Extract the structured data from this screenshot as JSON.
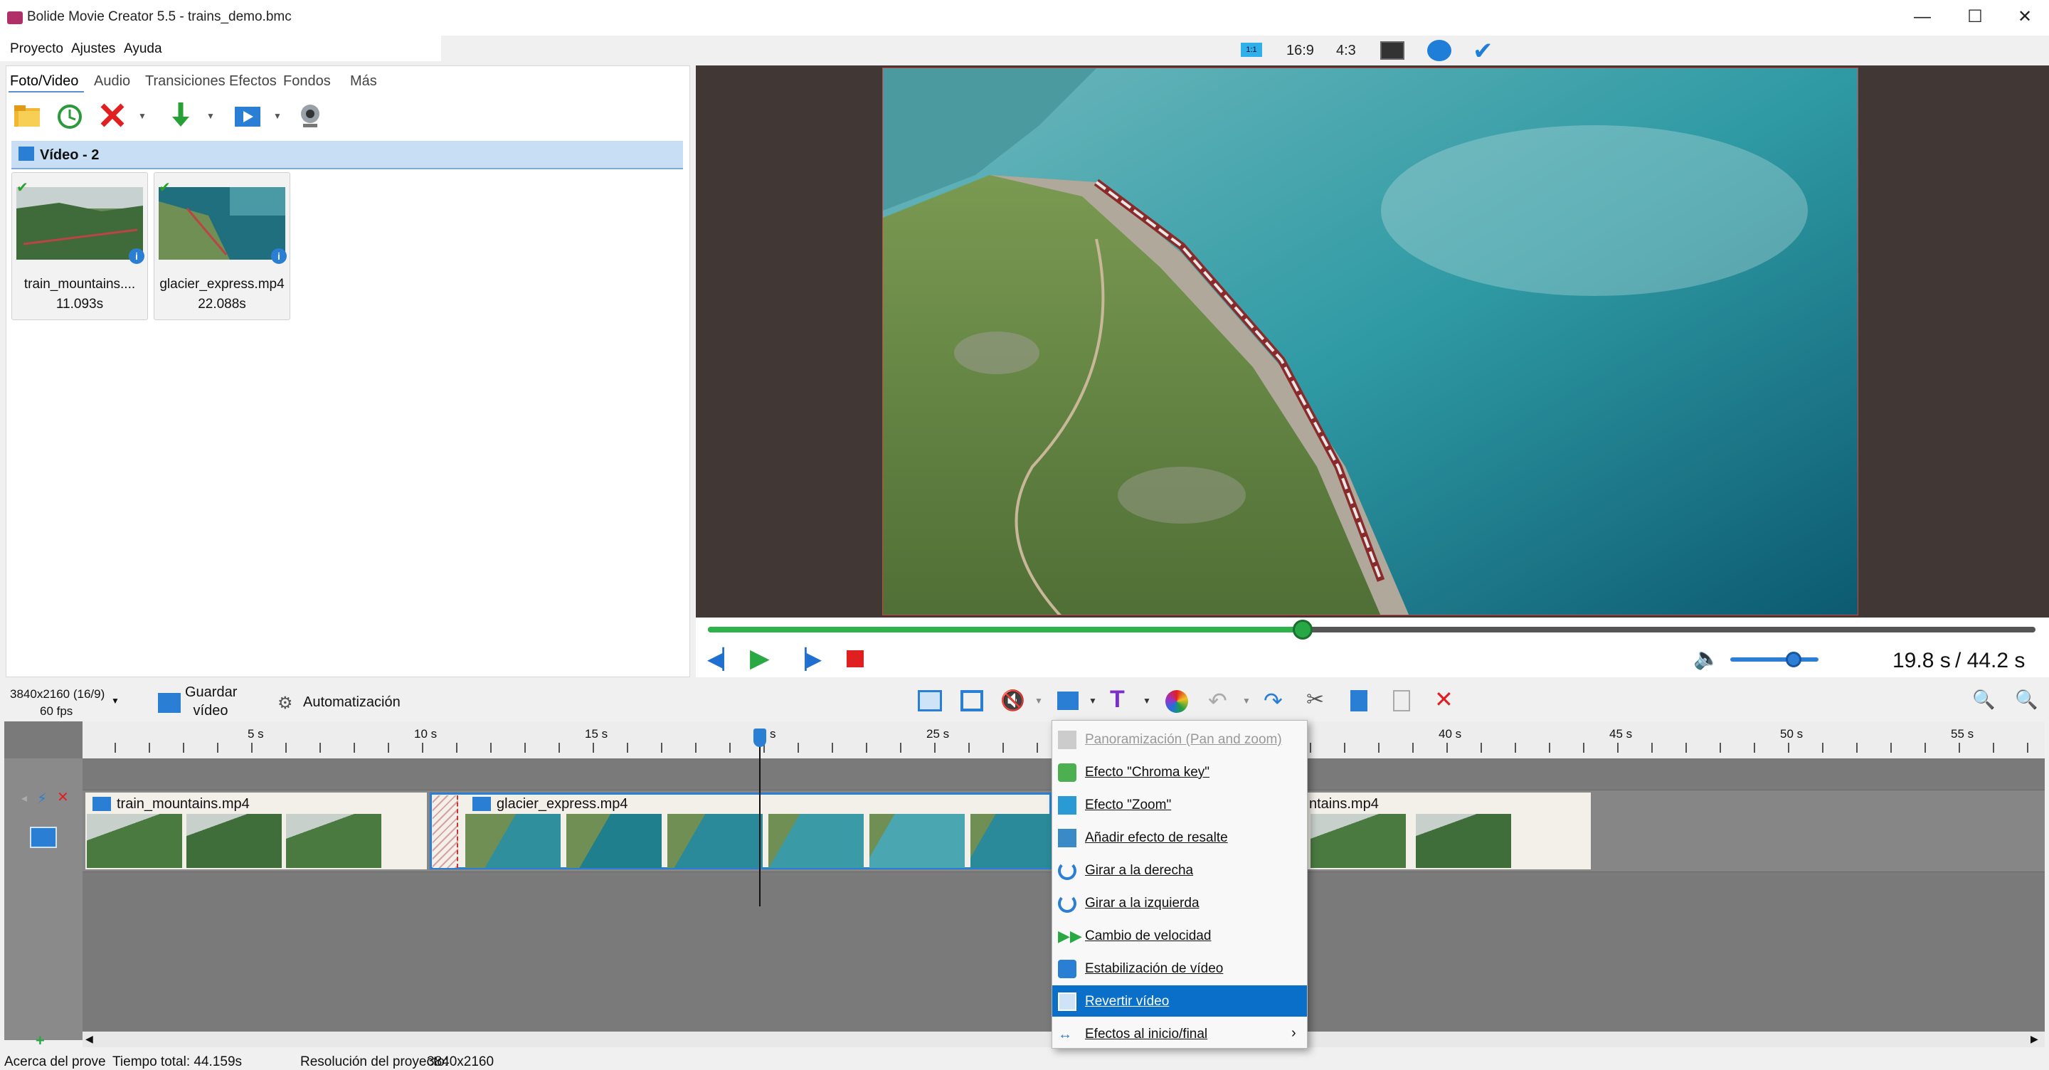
{
  "window": {
    "title": "Bolide Movie Creator 5.5 - trains_demo.bmc"
  },
  "menubar": [
    "Proyecto",
    "Ajustes",
    "Ayuda"
  ],
  "top_icons": {
    "ratio_1_1": "1:1",
    "ratio_16_9": "16:9",
    "ratio_4_3": "4:3"
  },
  "left_tabs": [
    "Foto/Video",
    "Audio",
    "Transiciones",
    "Efectos",
    "Fondos",
    "Más"
  ],
  "media_group": {
    "title": "Vídeo - 2"
  },
  "media_items": [
    {
      "name": "train_mountains....",
      "duration": "11.093s"
    },
    {
      "name": "glacier_express.mp4",
      "duration": "22.088s"
    }
  ],
  "player": {
    "current_time": "19.8 s",
    "total_time": "/ 44.2 s",
    "progress": 0.448,
    "volume": 0.72
  },
  "bottom_toolbar": {
    "resolution": "3840x2160 (16/9)",
    "fps": "60 fps",
    "save_video_line1": "Guardar",
    "save_video_line2": "vídeo",
    "automation": "Automatización"
  },
  "ruler_labels": [
    "5 s",
    "10 s",
    "15 s",
    "s",
    "25 s",
    "40 s",
    "45 s",
    "50 s",
    "55 s"
  ],
  "clips": [
    {
      "name": "train_mountains.mp4"
    },
    {
      "name": "glacier_express.mp4"
    },
    {
      "name": "ntains.mp4"
    }
  ],
  "context_menu": [
    {
      "label": "Panoramización (Pan and zoom)",
      "disabled": true
    },
    {
      "label": "Efecto \"Chroma key\""
    },
    {
      "label": "Efecto \"Zoom\""
    },
    {
      "label": "Añadir efecto de resalte"
    },
    {
      "label": "Girar a la derecha"
    },
    {
      "label": "Girar a la izquierda"
    },
    {
      "label": "Cambio de velocidad"
    },
    {
      "label": "Estabilización de vídeo"
    },
    {
      "label": "Revertir vídeo",
      "highlighted": true
    },
    {
      "label": "Efectos al inicio/final",
      "submenu": true
    }
  ],
  "statusbar": {
    "about": "Acerca del prove",
    "total_time": "Tiempo total: 44.159s",
    "resolution": "Resolución del proyecto:",
    "resolution_value": "3840x2160"
  },
  "colors": {
    "accent": "#0a6fc9",
    "seek": "#2db34a",
    "preview_bg": "#413835"
  }
}
